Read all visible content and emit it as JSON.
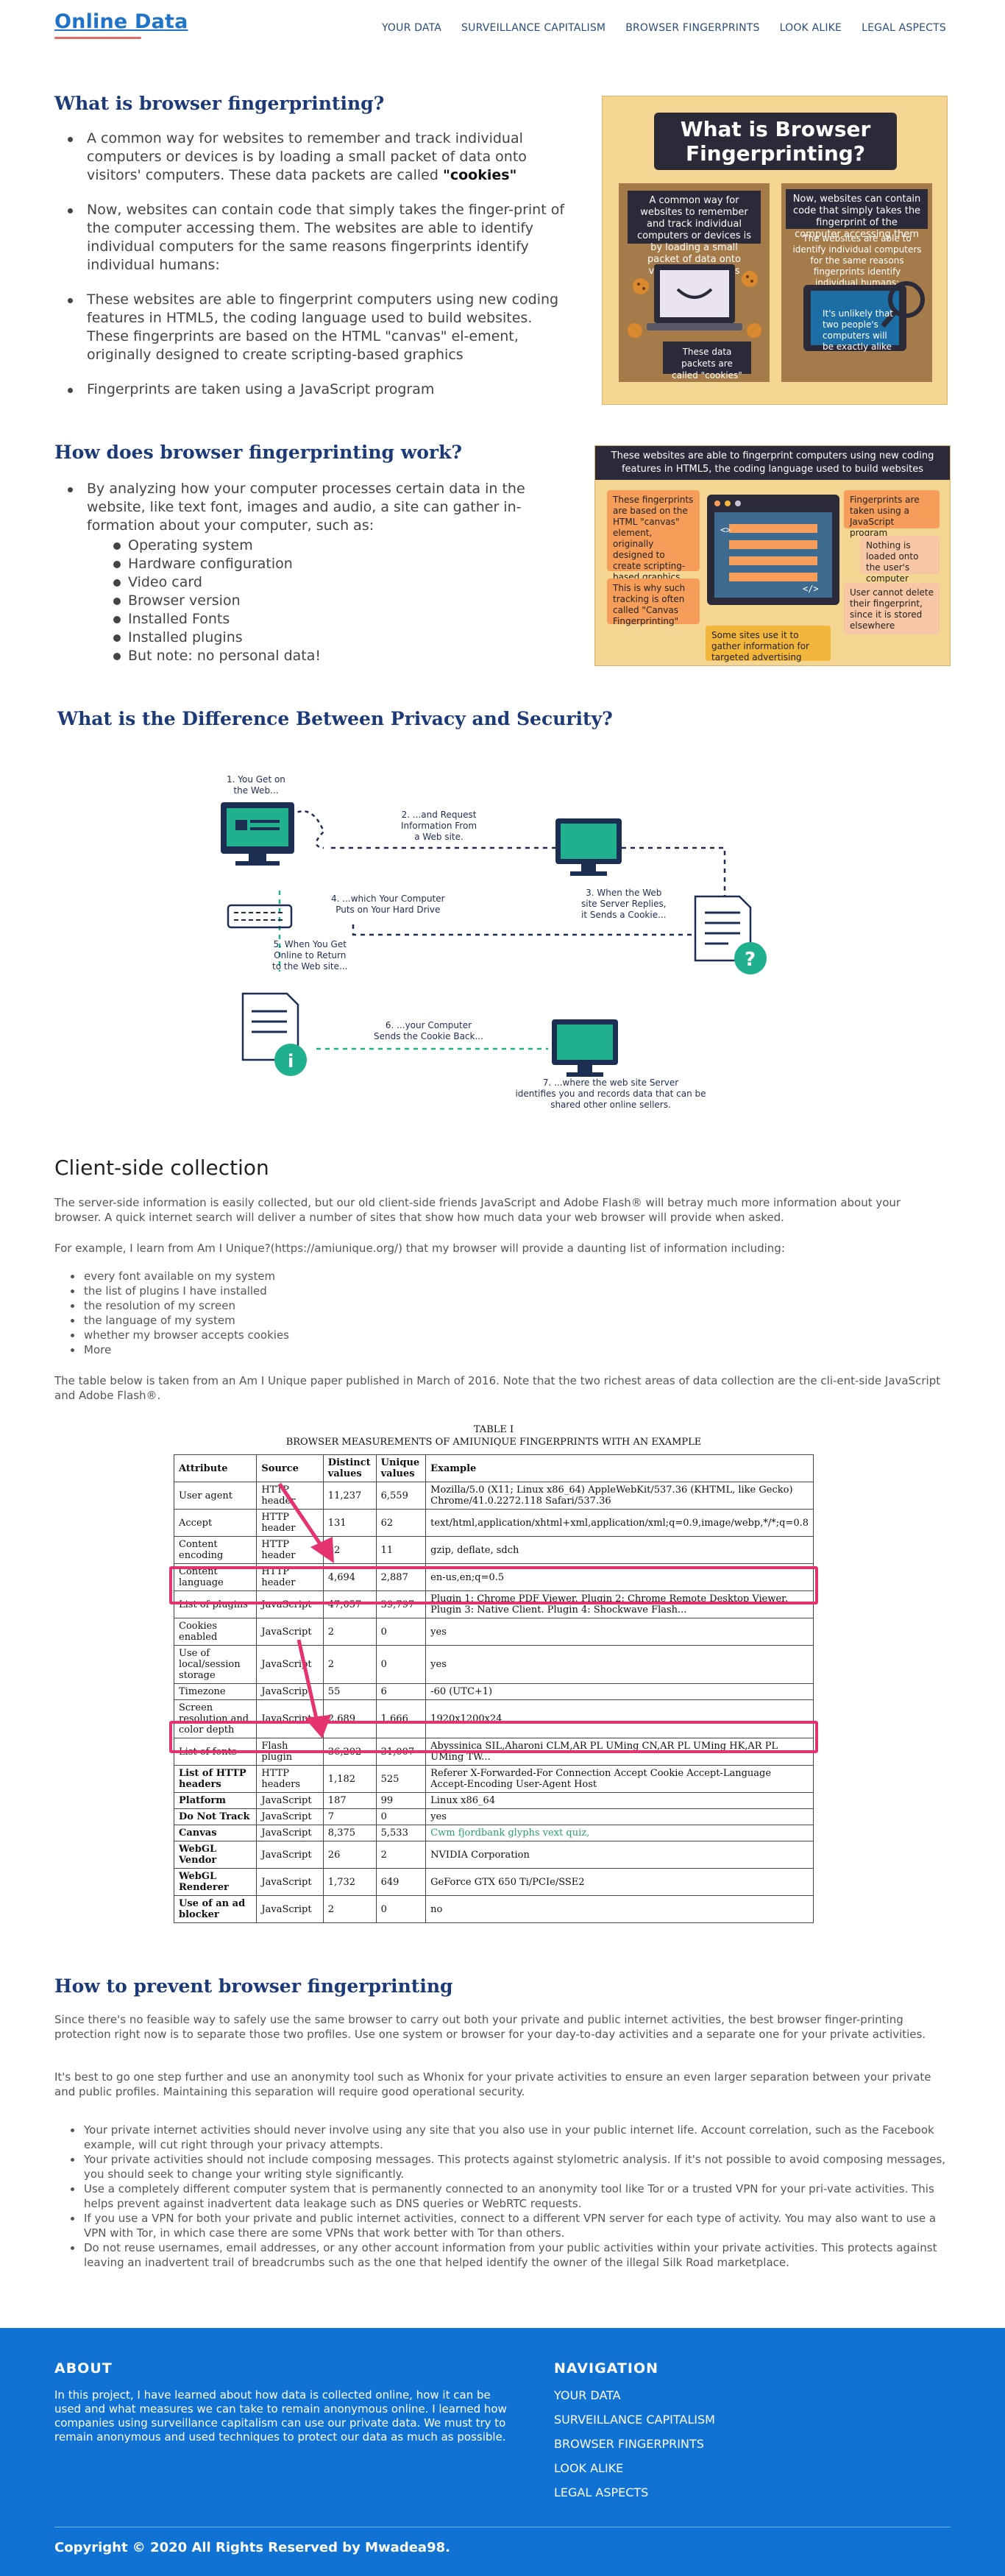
{
  "brand": {
    "name": "Online Data"
  },
  "nav": [
    "YOUR DATA",
    "SURVEILLANCE CAPITALISM",
    "BROWSER FINGERPRINTS",
    "LOOK ALIKE",
    "LEGAL ASPECTS"
  ],
  "section1": {
    "title": "What is browser fingerprinting?",
    "bullets": [
      "A common way for websites to remember and track individual computers or devices is by loading a small packet of data onto visitors' computers. These data packets are called",
      "Now, websites can contain code that simply takes the finger-print of the computer accessing them. The websites are able to identify individual computers for the same reasons fingerprints identify individual humans:",
      "These websites are able to fingerprint computers using new coding features in HTML5, the coding language used to build websites. These fingerprints are based on the HTML \"canvas\" el-ement, originally designed to create scripting-based graphics",
      "Fingerprints are taken using a JavaScript program"
    ],
    "cookies_word": "\"cookies\""
  },
  "info1": {
    "title": "What is Browser Fingerprinting?",
    "left_text": "A common way for websites to remember and track individual computers or devices is by loading a small packet of data onto visitors' computers",
    "left_caption": "These data packets are called \"cookies\"",
    "right_text": "Now, websites can contain code that simply takes the fingerprint of the computer accessing them",
    "right_sub": "The websites are able to identify individual computers for the same reasons fingerprints identify individual humans:",
    "right_caption": "It's unlikely that two people's computers will be exactly alike"
  },
  "section2": {
    "title": "How does browser fingerprinting work?",
    "bullet": "By analyzing how your computer processes certain data in the website, like text font, images and audio, a site can gather in-formation about your computer, such as:",
    "subitems": [
      "Operating system",
      "Hardware configuration",
      "Video card",
      "Browser version",
      "Installed Fonts",
      "Installed plugins",
      "But note: no personal data!"
    ]
  },
  "info2": {
    "top": "These websites are able to fingerprint computers using new coding features in HTML5, the coding language used to build websites",
    "card_a": "These fingerprints are based on the HTML \"canvas\" element, originally designed to create scripting-based graphics",
    "card_b": "This is why such tracking is often called \"Canvas Fingerprinting\"",
    "card_c": "Fingerprints are taken using a JavaScript program",
    "card_d": "Nothing is loaded onto the user's computer",
    "card_e": "User cannot delete their fingerprint, since it is stored elsewhere",
    "card_f": "Some sites use it to gather information for targeted advertising"
  },
  "section3": {
    "title": "What is the Difference Between Privacy and Security?"
  },
  "diagram": {
    "step1": [
      "1. You Get on",
      "the Web..."
    ],
    "step2": [
      "2. ...and Request",
      "Information From",
      "a Web site."
    ],
    "step3": [
      "3. When the Web",
      "site Server Replies,",
      "it Sends a Cookie..."
    ],
    "step4": [
      "4. ...which Your Computer",
      "Puts on Your Hard Drive"
    ],
    "step5": [
      "5. When You Get",
      "Online to Return",
      "to the Web site..."
    ],
    "step6": [
      "6. ...your Computer",
      "Sends the Cookie Back..."
    ],
    "step7": [
      "7. ...where the web site Server",
      "identifies you and records data that can be",
      "shared other online sellers."
    ]
  },
  "client": {
    "title": "Client-side collection",
    "p1": "The server-side information is easily collected, but our old client-side friends JavaScript and Adobe Flash® will betray much more information about your browser. A quick internet search will deliver a number of sites that show how much data your web browser will provide when asked.",
    "p2": "For example, I learn from Am I Unique?(https://amiunique.org/) that my browser will provide a daunting list of information including:",
    "items": [
      "every font available on my system",
      "the list of plugins I have installed",
      "the resolution of my screen",
      "the language of my system",
      "whether my browser accepts cookies",
      "More"
    ],
    "p3": "The table below is taken from an Am I Unique paper published in March of 2016. Note that the two richest areas of data collection are the cli-ent-side JavaScript and Adobe Flash®."
  },
  "table": {
    "caption1": "TABLE I",
    "caption2": "BROWSER MEASUREMENTS OF AMIUNIQUE FINGERPRINTS WITH AN EXAMPLE",
    "headers": [
      "Attribute",
      "Source",
      "Distinct values",
      "Unique values",
      "Example"
    ],
    "rows": [
      [
        "User agent",
        "HTTP header",
        "11,237",
        "6,559",
        "Mozilla/5.0 (X11; Linux x86_64) AppleWebKit/537.36 (KHTML, like Gecko) Chrome/41.0.2272.118 Safari/537.36"
      ],
      [
        "Accept",
        "HTTP header",
        "131",
        "62",
        "text/html,application/xhtml+xml,application/xml;q=0.9,image/webp,*/*;q=0.8"
      ],
      [
        "Content encoding",
        "HTTP header",
        "42",
        "11",
        "gzip, deflate, sdch"
      ],
      [
        "Content language",
        "HTTP header",
        "4,694",
        "2,887",
        "en-us,en;q=0.5"
      ],
      [
        "List of plugins",
        "JavaScript",
        "47,057",
        "39,797",
        "Plugin 1: Chrome PDF Viewer. Plugin 2: Chrome Remote Desktop Viewer. Plugin 3: Native Client. Plugin 4: Shockwave Flash..."
      ],
      [
        "Cookies enabled",
        "JavaScript",
        "2",
        "0",
        "yes"
      ],
      [
        "Use of local/session storage",
        "JavaScript",
        "2",
        "0",
        "yes"
      ],
      [
        "Timezone",
        "JavaScript",
        "55",
        "6",
        "-60 (UTC+1)"
      ],
      [
        "Screen resolution and color depth",
        "JavaScript",
        "2,689",
        "1,666",
        "1920x1200x24"
      ],
      [
        "List of fonts",
        "Flash plugin",
        "36,202",
        "31,007",
        "Abyssinica SIL,Aharoni CLM,AR PL UMing CN,AR PL UMing HK,AR PL UMing TW..."
      ],
      [
        "List of HTTP headers",
        "HTTP headers",
        "1,182",
        "525",
        "Referer X-Forwarded-For Connection Accept Cookie Accept-Language Accept-Encoding User-Agent Host"
      ],
      [
        "Platform",
        "JavaScript",
        "187",
        "99",
        "Linux x86_64"
      ],
      [
        "Do Not Track",
        "JavaScript",
        "7",
        "0",
        "yes"
      ],
      [
        "Canvas",
        "JavaScript",
        "8,375",
        "5,533",
        "Cwm fjordbank glyphs vext quiz,"
      ],
      [
        "WebGL Vendor",
        "JavaScript",
        "26",
        "2",
        "NVIDIA Corporation"
      ],
      [
        "WebGL Renderer",
        "JavaScript",
        "1,732",
        "649",
        "GeForce GTX 650 Ti/PCIe/SSE2"
      ],
      [
        "Use of an ad blocker",
        "JavaScript",
        "2",
        "0",
        "no"
      ]
    ]
  },
  "prevent": {
    "title": "How to prevent browser fingerprinting",
    "p1": "Since there's no feasible way to safely use the same browser to carry out both your private and public internet activities, the best browser finger-printing protection right now is to separate those two profiles. Use one system or browser for your day-to-day activities and a separate one for your private activities.",
    "p2": "It's best to go one step further and use an anonymity tool such as Whonix for your private activities to ensure an even larger separation between your private and public profiles. Maintaining this separation will require good operational security.",
    "items": [
      "Your private internet activities should never involve using any site that you also use in your public internet life. Account correlation, such as the Facebook example, will cut right through your privacy attempts.",
      "Your private activities should not include composing messages. This protects against stylometric analysis. If it's not possible to avoid composing messages, you should seek to change your writing style significantly.",
      "Use a completely different computer system that is permanently connected to an anonymity tool like Tor or a trusted VPN for your pri-vate activities. This helps prevent against inadvertent data leakage such as DNS queries or WebRTC requests.",
      "If you use a VPN for both your private and public internet activities, connect to a different VPN server for each type of activity. You may also want to use a VPN with Tor, in which case there are some VPNs that work better with Tor than others.",
      "Do not reuse usernames, email addresses, or any other account information from your public activities within your private activities. This protects against leaving an inadvertent trail of breadcrumbs such as the one that helped identify the owner of the illegal Silk Road marketplace."
    ]
  },
  "footer": {
    "about_title": "ABOUT",
    "about_text": "In this project, I have learned about how data is collected online, how it can be used and what measures we can take to remain anonymous online. I learned how companies using surveillance capitalism can use our private data. We must try to remain anonymous and used techniques to protect our data as much as possible.",
    "nav_title": "NAVIGATION",
    "links": [
      "YOUR DATA",
      "SURVEILLANCE CAPITALISM",
      "BROWSER FINGERPRINTS",
      "LOOK ALIKE",
      "LEGAL ASPECTS"
    ],
    "copyright": "Copyright © 2020 All Rights Reserved by Mwadea98."
  },
  "colors": {
    "brand": "#1f73c9",
    "heading": "#1c3a78",
    "footer": "#1073d3",
    "highlight": "#e5336f",
    "teal": "#21b08e"
  }
}
